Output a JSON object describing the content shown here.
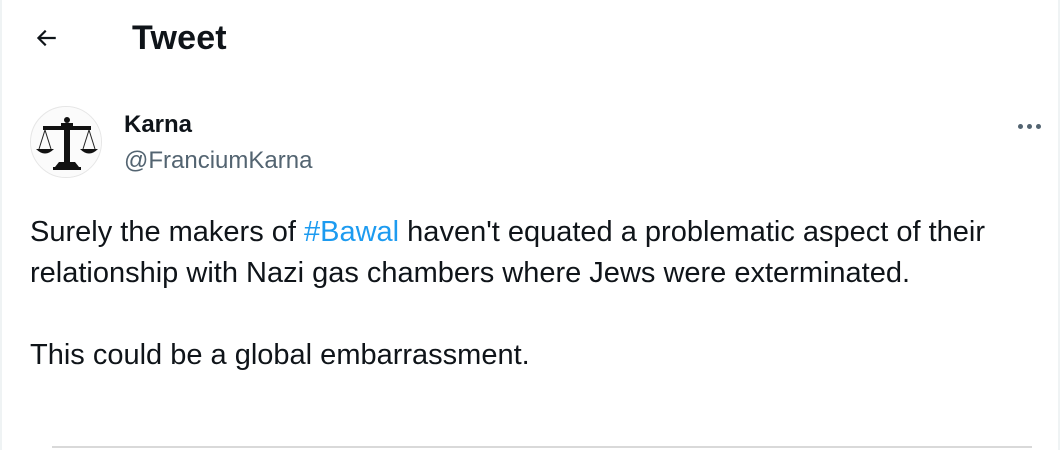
{
  "header": {
    "title": "Tweet",
    "back_icon": "arrow-left-icon"
  },
  "tweet": {
    "author": {
      "display_name": "Karna",
      "handle": "@FranciumKarna",
      "avatar_icon": "scales-of-justice-icon"
    },
    "more_icon": "more-horizontal-icon",
    "text": {
      "line1_before": "Surely the makers of ",
      "hashtag": "#Bawal",
      "line1_after": " haven't equated a problematic aspect of their relationship with Nazi gas chambers where Jews were exterminated.",
      "line2": "This could be a global embarrassment."
    }
  },
  "colors": {
    "text_primary": "#0f1419",
    "text_secondary": "#536471",
    "link": "#1d9bf0",
    "border": "#eff3f4"
  }
}
